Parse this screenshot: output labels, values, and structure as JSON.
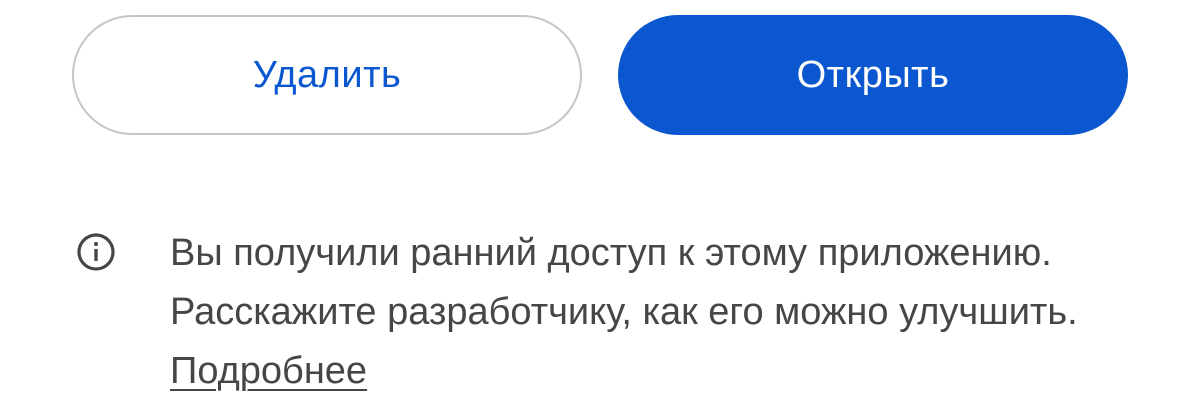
{
  "buttons": {
    "uninstall_label": "Удалить",
    "open_label": "Открыть"
  },
  "notice": {
    "icon": "info-icon",
    "text": "Вы получили ранний доступ к этому приложению. Расскажите разработчику, как его можно улучшить.",
    "link_label": "Подробнее"
  },
  "colors": {
    "accent": "#0b57d0",
    "outline": "#c4c7c5",
    "text": "#444746",
    "background": "#ffffff"
  }
}
